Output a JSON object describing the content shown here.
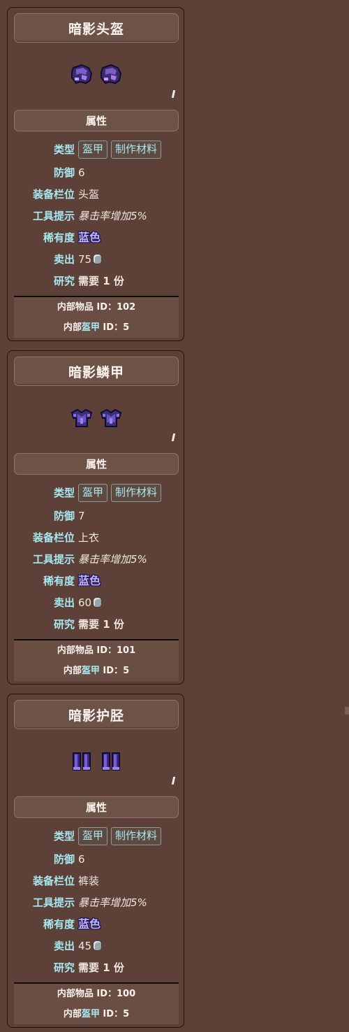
{
  "cards": [
    {
      "title": "暗影头盔",
      "item_icon": "shadow-helmet-icon",
      "attributes_header": "属性",
      "type_label": "类型",
      "type_tags": [
        "盔甲",
        "制作材料"
      ],
      "defense_label": "防御",
      "defense_value": "6",
      "slot_label": "装备栏位",
      "slot_value": "头盔",
      "tooltip_label": "工具提示",
      "tooltip_value": "暴击率增加5%",
      "rarity_label": "稀有度",
      "rarity_value": "蓝色",
      "sell_label": "卖出",
      "sell_value": "75",
      "research_label": "研究",
      "research_value": "需要 1 份",
      "internal_item_id_label": "内部物品 ID：",
      "internal_item_id": "102",
      "internal_armor_id_prefix": "内部",
      "internal_armor_id_cyan": "盔甲",
      "internal_armor_id_suffix": " ID：",
      "internal_armor_id": "5"
    },
    {
      "title": "暗影鳞甲",
      "item_icon": "shadow-scalemail-icon",
      "attributes_header": "属性",
      "type_label": "类型",
      "type_tags": [
        "盔甲",
        "制作材料"
      ],
      "defense_label": "防御",
      "defense_value": "7",
      "slot_label": "装备栏位",
      "slot_value": "上衣",
      "tooltip_label": "工具提示",
      "tooltip_value": "暴击率增加5%",
      "rarity_label": "稀有度",
      "rarity_value": "蓝色",
      "sell_label": "卖出",
      "sell_value": "60",
      "research_label": "研究",
      "research_value": "需要 1 份",
      "internal_item_id_label": "内部物品 ID：",
      "internal_item_id": "101",
      "internal_armor_id_prefix": "内部",
      "internal_armor_id_cyan": "盔甲",
      "internal_armor_id_suffix": " ID：",
      "internal_armor_id": "5"
    },
    {
      "title": "暗影护胫",
      "item_icon": "shadow-greaves-icon",
      "attributes_header": "属性",
      "type_label": "类型",
      "type_tags": [
        "盔甲",
        "制作材料"
      ],
      "defense_label": "防御",
      "defense_value": "6",
      "slot_label": "装备栏位",
      "slot_value": "裤装",
      "tooltip_label": "工具提示",
      "tooltip_value": "暴击率增加5%",
      "rarity_label": "稀有度",
      "rarity_value": "蓝色",
      "sell_label": "卖出",
      "sell_value": "45",
      "research_label": "研究",
      "research_value": "需要 1 份",
      "internal_item_id_label": "内部物品 ID：",
      "internal_item_id": "100",
      "internal_armor_id_prefix": "内部",
      "internal_armor_id_cyan": "盔甲",
      "internal_armor_id_suffix": " ID：",
      "internal_armor_id": "5"
    }
  ],
  "colors": {
    "background": "#5d4037",
    "label_cyan": "#a7e8f0",
    "rarity_blue": "#bdb6ff",
    "research_pink": "#ff5fcf"
  },
  "icons": {
    "sell_coin": "silver-coin-icon"
  }
}
